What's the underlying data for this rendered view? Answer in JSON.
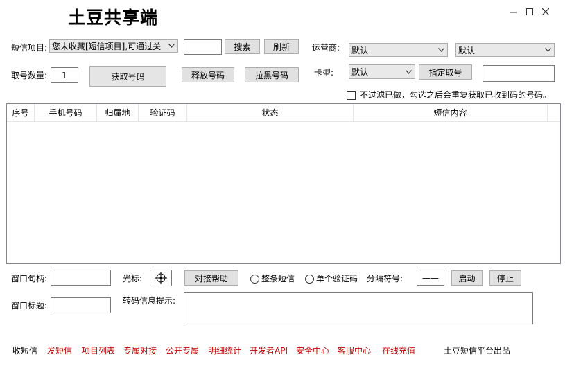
{
  "app": {
    "title": "土豆共享端"
  },
  "window_controls": {
    "minimize": "–",
    "maximize": "☐",
    "close": "✕"
  },
  "row1": {
    "sms_project_label": "短信项目:",
    "sms_project_value": "您未收藏[短信项目],可通过关",
    "search_value": "",
    "search_button": "搜索",
    "refresh_button": "刷新",
    "carrier_label": "运营商:",
    "carrier_value": "默认",
    "carrier2_value": "默认"
  },
  "row2": {
    "count_label": "取号数量:",
    "count_value": "1",
    "get_number_button": "获取号码",
    "release_button": "释放号码",
    "blacklist_button": "拉黑号码",
    "card_type_label": "卡型:",
    "card_type_value": "默认",
    "assign_button": "指定取号",
    "assign_value": ""
  },
  "filter": {
    "label": "不过滤已做，勾选之后会重复获取已收到码的号码。",
    "checked": false
  },
  "table": {
    "columns": [
      "序号",
      "手机号码",
      "归属地",
      "验证码",
      "状态",
      "短信内容"
    ],
    "rows": []
  },
  "bottom": {
    "handle_label": "窗口句柄:",
    "handle_value": "",
    "cursor_label": "光标:",
    "help_button": "对接帮助",
    "radio_whole": "整条短信",
    "radio_single": "单个验证码",
    "separator_label": "分隔符号:",
    "separator_value": "——",
    "start_button": "启动",
    "stop_button": "停止",
    "title_label": "窗口标题:",
    "title_value": "",
    "hint_label": "转码信息提示:",
    "hint_value": ""
  },
  "footer": {
    "links": [
      {
        "label": "收短信",
        "color": "#000000"
      },
      {
        "label": "发短信",
        "color": "#c00000"
      },
      {
        "label": "项目列表",
        "color": "#c00000"
      },
      {
        "label": "专属对接",
        "color": "#c00000"
      },
      {
        "label": "公开专属",
        "color": "#c00000"
      },
      {
        "label": "明细统计",
        "color": "#c00000"
      },
      {
        "label": "开发者API",
        "color": "#c00000"
      },
      {
        "label": "安全中心",
        "color": "#c00000"
      },
      {
        "label": "客服中心",
        "color": "#c00000"
      },
      {
        "label": "在线充值",
        "color": "#c00000"
      }
    ],
    "credit": "土豆短信平台出品"
  }
}
